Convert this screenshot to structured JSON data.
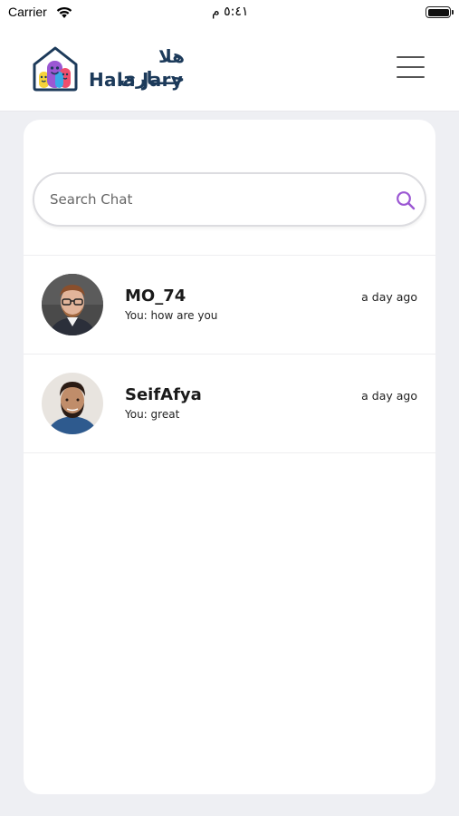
{
  "status_bar": {
    "carrier": "Carrier",
    "time": "٥:٤١ م"
  },
  "header": {
    "brand_arabic": "هلا جـــارى",
    "brand_latin": "Hala Jary"
  },
  "search": {
    "placeholder": "Search Chat",
    "value": ""
  },
  "chats": [
    {
      "name": "MO_74",
      "preview": "You: how are you",
      "time": "a day ago"
    },
    {
      "name": "SeifAfya",
      "preview": "You: great",
      "time": "a day ago"
    }
  ],
  "colors": {
    "accent": "#9b57d3",
    "brand": "#1c3a5a",
    "background": "#eeeff3"
  },
  "icons": {
    "search": "search-icon",
    "menu": "hamburger-icon",
    "wifi": "wifi-icon",
    "battery": "battery-icon"
  }
}
